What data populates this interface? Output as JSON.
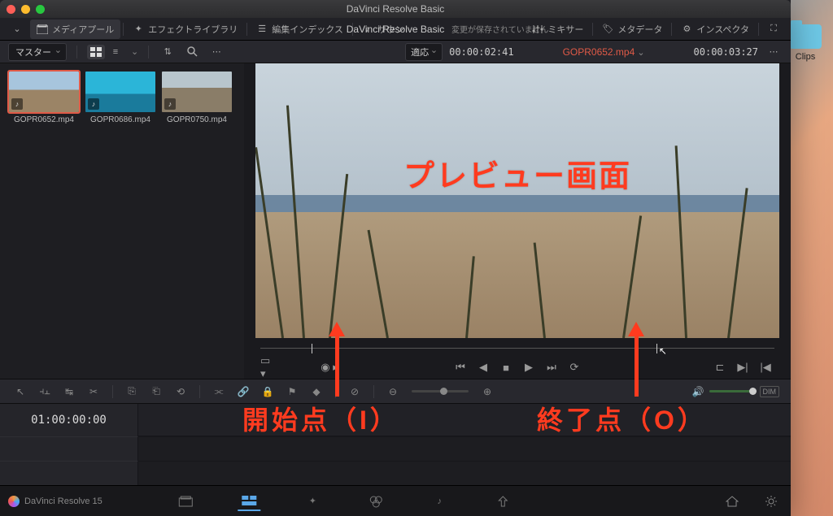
{
  "window": {
    "title": "DaVinci Resolve Basic"
  },
  "menubar": {
    "center_title": "DaVinci Resolve Basic",
    "unsaved": "変更が保存されていません",
    "items": {
      "media_pool": "メディアプール",
      "effects": "エフェクトライブラリ",
      "edit_index": "編集インデックス",
      "sound": "サウン",
      "mixer": "ミキサー",
      "metadata": "メタデータ",
      "inspector": "インスペクタ"
    }
  },
  "subbar": {
    "bin": "マスター",
    "fit_label": "適応",
    "in_tc": "00:00:02:41",
    "clip_name": "GOPR0652.mp4",
    "out_tc": "00:00:03:27"
  },
  "pool": {
    "clips": [
      {
        "name": "GOPR0652.mp4"
      },
      {
        "name": "GOPR0686.mp4"
      },
      {
        "name": "GOPR0750.mp4"
      }
    ]
  },
  "timeline": {
    "tc": "01:00:00:00"
  },
  "toolrow": {
    "dim": "DIM"
  },
  "bottom": {
    "brand": "DaVinci Resolve 15"
  },
  "desktop": {
    "folder": "Clips"
  },
  "annotations": {
    "preview": "プレビュー画面",
    "in_point": "開始点（I）",
    "out_point": "終了点（O）"
  }
}
